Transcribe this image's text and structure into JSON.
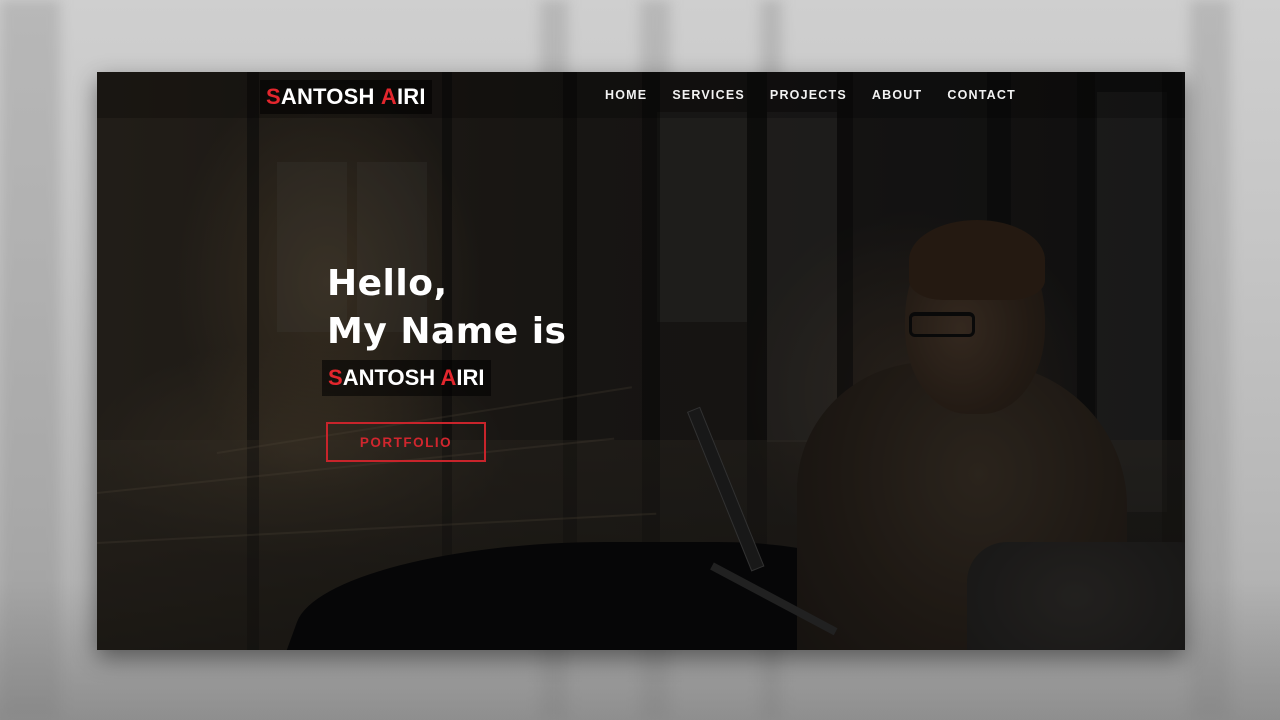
{
  "brand": {
    "first_initial": "S",
    "first_rest": "ANTOSH ",
    "last_initial": "A",
    "last_rest": "IRI"
  },
  "nav": {
    "items": [
      {
        "label": "HOME"
      },
      {
        "label": "SERVICES"
      },
      {
        "label": "PROJECTS"
      },
      {
        "label": "ABOUT"
      },
      {
        "label": "CONTACT"
      }
    ]
  },
  "hero": {
    "line1": "Hello,",
    "line2": "My Name is",
    "name": {
      "first_initial": "S",
      "first_rest": "ANTOSH ",
      "last_initial": "A",
      "last_rest": "IRI"
    },
    "button_label": "PORTFOLIO"
  },
  "colors": {
    "accent": "#e3262d",
    "text": "#ffffff"
  }
}
